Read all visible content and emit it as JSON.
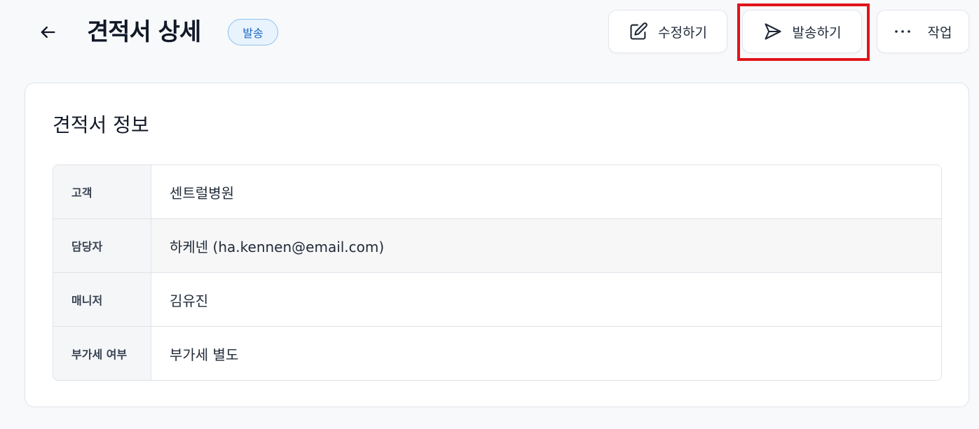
{
  "header": {
    "title": "견적서 상세",
    "status_badge": "발송",
    "buttons": {
      "edit_label": "수정하기",
      "send_label": "발송하기",
      "more_label": "작업"
    }
  },
  "card": {
    "title": "견적서 정보",
    "rows": [
      {
        "label": "고객",
        "value": "센트럴병원"
      },
      {
        "label": "담당자",
        "value": "하케넨 (ha.kennen@email.com)"
      },
      {
        "label": "매니저",
        "value": "김유진"
      },
      {
        "label": "부가세 여부",
        "value": "부가세 별도"
      }
    ]
  },
  "colors": {
    "badge_text": "#1b67c4",
    "badge_bg": "#e8f3fd",
    "highlight": "#e0141b"
  },
  "icons": [
    "arrow-left-icon",
    "pencil-icon",
    "send-icon",
    "ellipsis-icon"
  ]
}
